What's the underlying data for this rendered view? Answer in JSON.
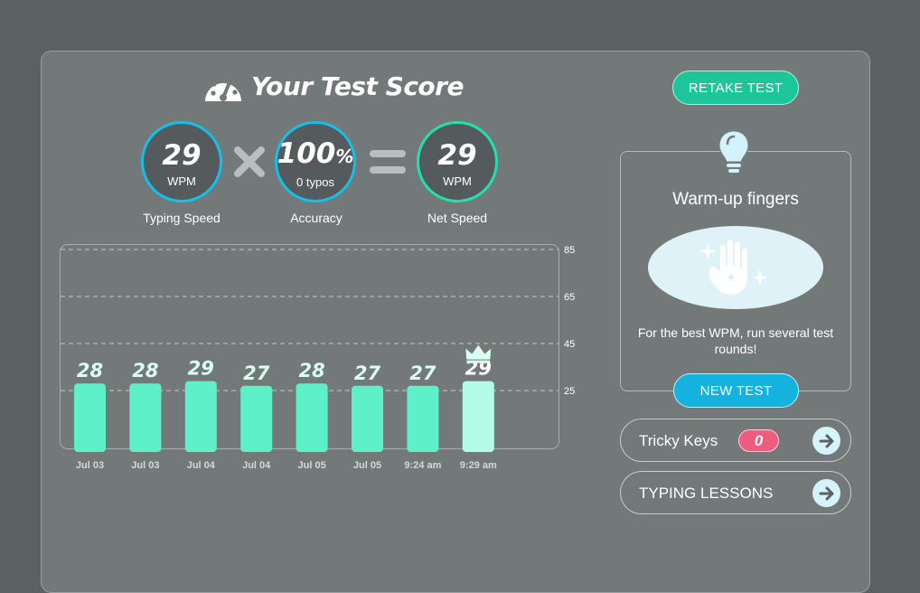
{
  "title": "Your Test Score",
  "metrics": {
    "typing_speed": {
      "value": "29",
      "unit": "WPM",
      "label": "Typing Speed"
    },
    "accuracy": {
      "value": "100",
      "suffix": "%",
      "sub": "0 typos",
      "label": "Accuracy"
    },
    "net_speed": {
      "value": "29",
      "unit": "WPM",
      "label": "Net Speed"
    }
  },
  "buttons": {
    "retake": "RETAKE TEST",
    "new_test": "NEW TEST"
  },
  "warmup": {
    "title": "Warm-up fingers",
    "description": "For the best WPM, run several test rounds!"
  },
  "tricky_keys": {
    "label": "Tricky Keys",
    "count": "0"
  },
  "lessons": {
    "label": "TYPING LESSONS"
  },
  "colors": {
    "bar": "#5ef0c8",
    "bar_highlight": "#b4fbe5",
    "accent_blue": "#14c0e8",
    "accent_green": "#22e0b0",
    "badge": "#ee5d7f"
  },
  "icons": [
    "speedometer-icon",
    "times-icon",
    "equals-icon",
    "lightbulb-icon",
    "sparkle-hand-icon",
    "crown-icon",
    "arrow-right-icon"
  ],
  "chart_data": {
    "type": "bar",
    "categories": [
      "Jul 03",
      "Jul 03",
      "Jul 04",
      "Jul 04",
      "Jul 05",
      "Jul 05",
      "9:24 am",
      "9:29 am"
    ],
    "values": [
      28,
      28,
      29,
      27,
      28,
      27,
      27,
      29
    ],
    "highlight_index": 7,
    "yticks": [
      85,
      65,
      45,
      25
    ],
    "ylim": [
      0,
      85
    ],
    "grid": "dashed horizontal",
    "title": "",
    "xlabel": "",
    "ylabel": ""
  }
}
